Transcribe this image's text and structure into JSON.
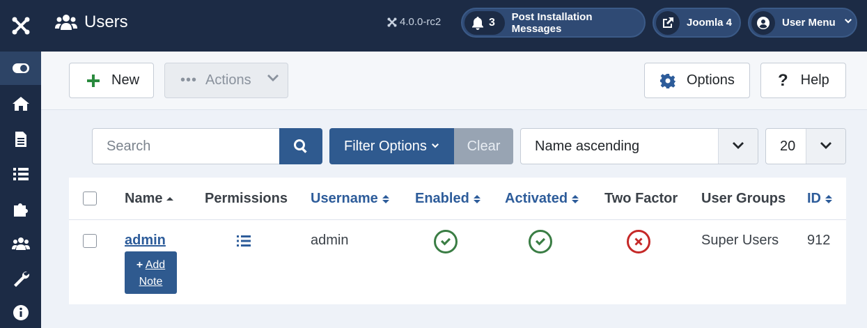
{
  "header": {
    "title": "Users",
    "version": "4.0.0-rc2",
    "post_install_count": "3",
    "post_install_label": "Post Installation Messages",
    "joomla_label": "Joomla 4",
    "user_menu_label": "User Menu"
  },
  "sidebar": {
    "items": [
      {
        "icon": "toggle-icon"
      },
      {
        "icon": "home-icon"
      },
      {
        "icon": "document-icon"
      },
      {
        "icon": "list-icon"
      },
      {
        "icon": "puzzle-icon"
      },
      {
        "icon": "users-icon"
      },
      {
        "icon": "wrench-icon"
      },
      {
        "icon": "info-icon"
      }
    ]
  },
  "toolbar": {
    "new_label": "New",
    "actions_label": "Actions",
    "options_label": "Options",
    "help_label": "Help"
  },
  "filters": {
    "search_placeholder": "Search",
    "filter_options_label": "Filter Options",
    "clear_label": "Clear",
    "sort_value": "Name ascending",
    "limit_value": "20"
  },
  "table": {
    "columns": {
      "name": "Name",
      "permissions": "Permissions",
      "username": "Username",
      "enabled": "Enabled",
      "activated": "Activated",
      "two_factor": "Two Factor",
      "user_groups": "User Groups",
      "id": "ID"
    },
    "rows": [
      {
        "name": "admin",
        "add_note_line1": "Add",
        "add_note_line2": "Note",
        "username": "admin",
        "enabled": true,
        "activated": true,
        "two_factor": false,
        "user_groups": "Super Users",
        "id": "912"
      }
    ]
  },
  "colors": {
    "header_bg": "#1c2b45",
    "primary": "#2f5a8f",
    "link": "#2d5c9a",
    "success": "#3a7d44",
    "danger": "#c52827"
  }
}
